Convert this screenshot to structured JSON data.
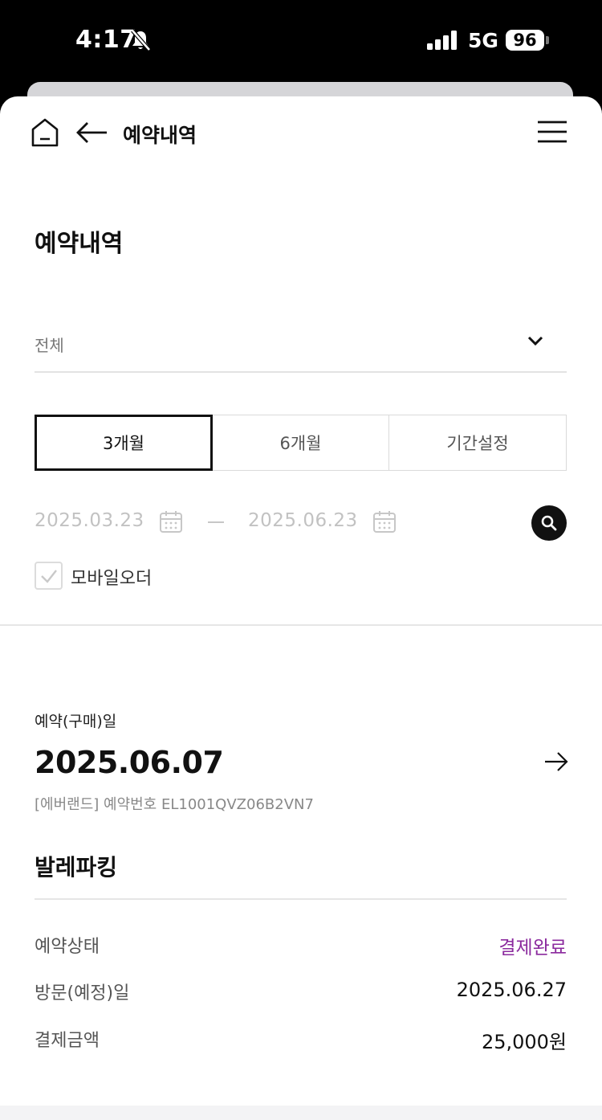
{
  "status_bar": {
    "time": "4:17",
    "network": "5G",
    "battery": "96"
  },
  "header": {
    "title": "예약내역"
  },
  "page": {
    "title": "예약내역"
  },
  "filter": {
    "dropdown_value": "전체",
    "periods": [
      "3개월",
      "6개월",
      "기간설정"
    ],
    "selected_period": "3개월",
    "start_date": "2025.03.23",
    "end_date": "2025.06.23",
    "mobile_order_label": "모바일오더",
    "mobile_order_checked": true
  },
  "reservation": {
    "date_label": "예약(구매)일",
    "date": "2025.06.07",
    "reservation_no": "[에버랜드] 예약번호 EL1001QVZ06B2VN7",
    "service": "발레파킹",
    "rows": [
      {
        "label": "예약상태",
        "value": "결제완료"
      },
      {
        "label": "방문(예정)일",
        "value": "2025.06.27"
      },
      {
        "label": "결제금액",
        "value": "25,000원"
      }
    ]
  },
  "colors": {
    "status_done": "#8b2a9e",
    "selected_tab_border": "#111111"
  }
}
